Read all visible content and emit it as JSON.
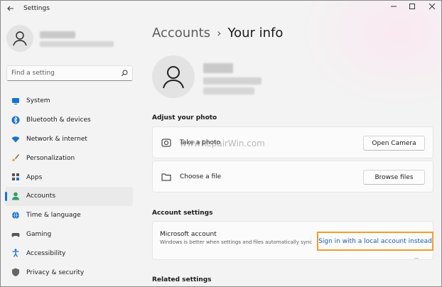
{
  "window": {
    "title": "Settings"
  },
  "sidebar": {
    "search_placeholder": "Find a setting",
    "items": [
      {
        "label": "System",
        "icon": "monitor-icon"
      },
      {
        "label": "Bluetooth & devices",
        "icon": "bluetooth-icon"
      },
      {
        "label": "Network & internet",
        "icon": "wifi-icon"
      },
      {
        "label": "Personalization",
        "icon": "brush-icon"
      },
      {
        "label": "Apps",
        "icon": "apps-icon"
      },
      {
        "label": "Accounts",
        "icon": "person-icon",
        "active": true
      },
      {
        "label": "Time & language",
        "icon": "globe-icon"
      },
      {
        "label": "Gaming",
        "icon": "gamepad-icon"
      },
      {
        "label": "Accessibility",
        "icon": "accessibility-icon"
      },
      {
        "label": "Privacy & security",
        "icon": "shield-icon"
      }
    ]
  },
  "main": {
    "breadcrumb_parent": "Accounts",
    "breadcrumb_separator": "›",
    "breadcrumb_current": "Your info",
    "adjust_photo_heading": "Adjust your photo",
    "take_photo_label": "Take a photo",
    "open_camera_button": "Open Camera",
    "choose_file_label": "Choose a file",
    "browse_files_button": "Browse files",
    "account_settings_heading": "Account settings",
    "ms_account_title": "Microsoft account",
    "ms_account_desc": "Windows is better when settings and files automatically sync",
    "local_account_link": "Sign in with a local account instead",
    "related_heading": "Related settings",
    "watermark": "wwwRepairWin.com"
  },
  "colors": {
    "accent": "#1a73c9",
    "link": "#1a5fb4",
    "highlight_border": "#f39c2b"
  }
}
